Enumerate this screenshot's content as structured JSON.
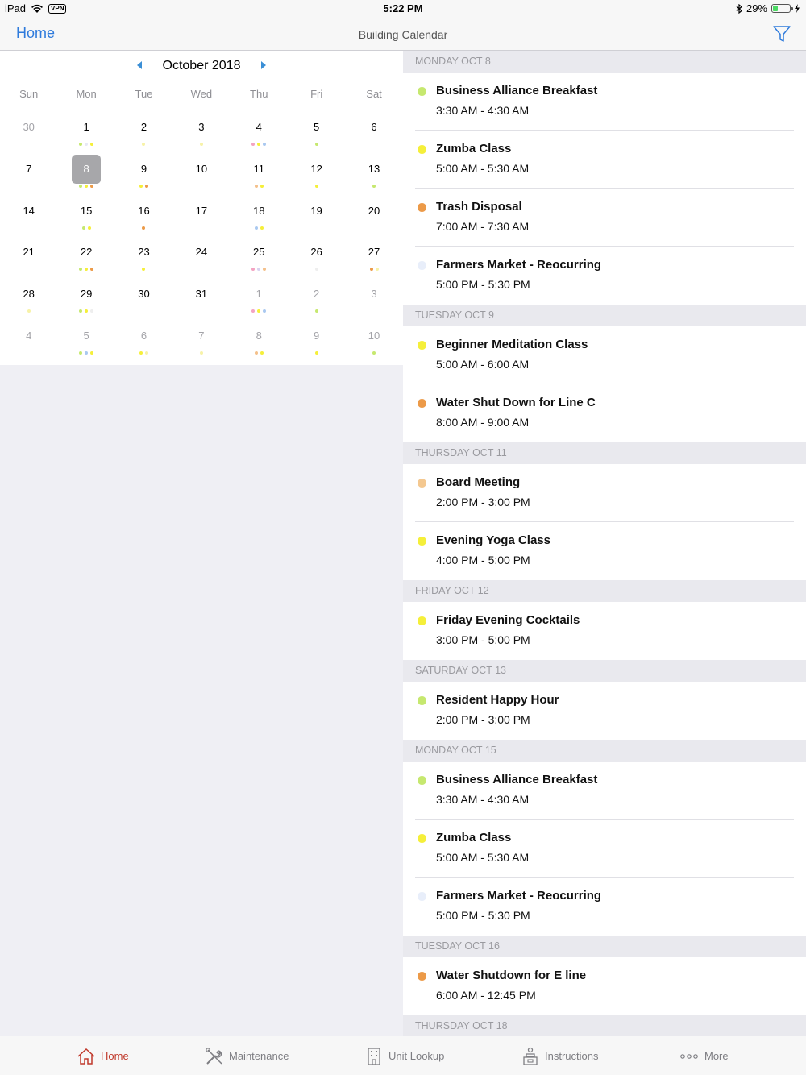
{
  "status_bar": {
    "device": "iPad",
    "vpn": "VPN",
    "time": "5:22 PM",
    "battery": "29%"
  },
  "nav": {
    "back_label": "Home",
    "title": "Building Calendar"
  },
  "calendar": {
    "month_label": "October 2018",
    "weekdays": [
      "Sun",
      "Mon",
      "Tue",
      "Wed",
      "Thu",
      "Fri",
      "Sat"
    ],
    "weeks": [
      [
        {
          "d": "30",
          "o": true,
          "dots": []
        },
        {
          "d": "1",
          "dots": [
            "#c6e86f",
            "#e7e8f5",
            "#f5ef3a"
          ]
        },
        {
          "d": "2",
          "dots": [
            "#f7f2a8"
          ]
        },
        {
          "d": "3",
          "dots": [
            "#f7f2a8"
          ]
        },
        {
          "d": "4",
          "dots": [
            "#f3a3c2",
            "#f5ef3a",
            "#a9c8f0"
          ]
        },
        {
          "d": "5",
          "dots": [
            "#c6e86f"
          ]
        },
        {
          "d": "6",
          "dots": []
        }
      ],
      [
        {
          "d": "7",
          "dots": []
        },
        {
          "d": "8",
          "sel": true,
          "dots": [
            "#c6e86f",
            "#f5ef3a",
            "#ec9a48"
          ]
        },
        {
          "d": "9",
          "dots": [
            "#f5ef3a",
            "#ec9a48"
          ]
        },
        {
          "d": "10",
          "dots": []
        },
        {
          "d": "11",
          "dots": [
            "#f4c08a",
            "#f5ef3a"
          ]
        },
        {
          "d": "12",
          "dots": [
            "#f5ef3a"
          ]
        },
        {
          "d": "13",
          "dots": [
            "#c6e86f"
          ]
        }
      ],
      [
        {
          "d": "14",
          "dots": []
        },
        {
          "d": "15",
          "dots": [
            "#c6e86f",
            "#f5ef3a"
          ]
        },
        {
          "d": "16",
          "dots": [
            "#ec9a48"
          ]
        },
        {
          "d": "17",
          "dots": []
        },
        {
          "d": "18",
          "dots": [
            "#a9c8f0",
            "#f5ef3a"
          ]
        },
        {
          "d": "19",
          "dots": []
        },
        {
          "d": "20",
          "dots": []
        }
      ],
      [
        {
          "d": "21",
          "dots": []
        },
        {
          "d": "22",
          "dots": [
            "#c6e86f",
            "#f5ef3a",
            "#ec9a48"
          ]
        },
        {
          "d": "23",
          "dots": [
            "#f5ef3a"
          ]
        },
        {
          "d": "24",
          "dots": []
        },
        {
          "d": "25",
          "dots": [
            "#f3a3c2",
            "#d9d3f0",
            "#f4c08a"
          ]
        },
        {
          "d": "26",
          "dots": [
            "#eeeeee"
          ]
        },
        {
          "d": "27",
          "dots": [
            "#ec9a48",
            "#f7f2a8"
          ]
        }
      ],
      [
        {
          "d": "28",
          "dots": [
            "#f7f2a8"
          ]
        },
        {
          "d": "29",
          "dots": [
            "#c6e86f",
            "#f5ef3a",
            "#eeeeee"
          ]
        },
        {
          "d": "30",
          "dots": []
        },
        {
          "d": "31",
          "dots": []
        },
        {
          "d": "1",
          "o": true,
          "dots": [
            "#f3a3c2",
            "#f5ef3a",
            "#a9c8f0"
          ]
        },
        {
          "d": "2",
          "o": true,
          "dots": [
            "#c6e86f"
          ]
        },
        {
          "d": "3",
          "o": true,
          "dots": []
        }
      ],
      [
        {
          "d": "4",
          "o": true,
          "dots": []
        },
        {
          "d": "5",
          "o": true,
          "dots": [
            "#c6e86f",
            "#a9c8f0",
            "#f5ef3a"
          ]
        },
        {
          "d": "6",
          "o": true,
          "dots": [
            "#f5ef3a",
            "#f7f2a8"
          ]
        },
        {
          "d": "7",
          "o": true,
          "dots": [
            "#f7f2a8"
          ]
        },
        {
          "d": "8",
          "o": true,
          "dots": [
            "#f4c08a",
            "#f5ef3a"
          ]
        },
        {
          "d": "9",
          "o": true,
          "dots": [
            "#f5ef3a"
          ]
        },
        {
          "d": "10",
          "o": true,
          "dots": [
            "#c6e86f"
          ]
        }
      ]
    ]
  },
  "event_sections": [
    {
      "header": "MONDAY OCT 8",
      "events": [
        {
          "title": "Business Alliance Breakfast",
          "time": "3:30 AM - 4:30 AM",
          "color": "#c6e86f"
        },
        {
          "title": "Zumba Class",
          "time": "5:00 AM - 5:30 AM",
          "color": "#f5ef3a"
        },
        {
          "title": "Trash Disposal",
          "time": "7:00 AM - 7:30 AM",
          "color": "#ec9a48"
        },
        {
          "title": "Farmers Market - Reocurring",
          "time": "5:00 PM - 5:30 PM",
          "color": "#e8eefa"
        }
      ]
    },
    {
      "header": "TUESDAY OCT 9",
      "events": [
        {
          "title": "Beginner Meditation Class",
          "time": "5:00 AM - 6:00 AM",
          "color": "#f5ef3a"
        },
        {
          "title": "Water Shut Down for Line C",
          "time": "8:00 AM - 9:00 AM",
          "color": "#ec9a48"
        }
      ]
    },
    {
      "header": "THURSDAY OCT 11",
      "events": [
        {
          "title": "Board Meeting",
          "time": "2:00 PM - 3:00 PM",
          "color": "#f4c890"
        },
        {
          "title": "Evening Yoga Class",
          "time": "4:00 PM - 5:00 PM",
          "color": "#f5ef3a"
        }
      ]
    },
    {
      "header": "FRIDAY OCT 12",
      "events": [
        {
          "title": "Friday Evening Cocktails",
          "time": "3:00 PM - 5:00 PM",
          "color": "#f5ef3a"
        }
      ]
    },
    {
      "header": "SATURDAY OCT 13",
      "events": [
        {
          "title": "Resident Happy Hour",
          "time": "2:00 PM - 3:00 PM",
          "color": "#c6e86f"
        }
      ]
    },
    {
      "header": "MONDAY OCT 15",
      "events": [
        {
          "title": "Business Alliance Breakfast",
          "time": "3:30 AM - 4:30 AM",
          "color": "#c6e86f"
        },
        {
          "title": "Zumba Class",
          "time": "5:00 AM - 5:30 AM",
          "color": "#f5ef3a"
        },
        {
          "title": "Farmers Market - Reocurring",
          "time": "5:00 PM - 5:30 PM",
          "color": "#e8eefa"
        }
      ]
    },
    {
      "header": "TUESDAY OCT 16",
      "events": [
        {
          "title": "Water Shutdown for E line",
          "time": "6:00 AM - 12:45 PM",
          "color": "#ec9a48"
        }
      ]
    },
    {
      "header": "THURSDAY OCT 18",
      "events": []
    }
  ],
  "tabbar": {
    "home": "Home",
    "maintenance": "Maintenance",
    "unit_lookup": "Unit Lookup",
    "instructions": "Instructions",
    "more": "More"
  },
  "colors": {
    "accent": "#2f7bdc",
    "tab_active": "#c0392b"
  }
}
